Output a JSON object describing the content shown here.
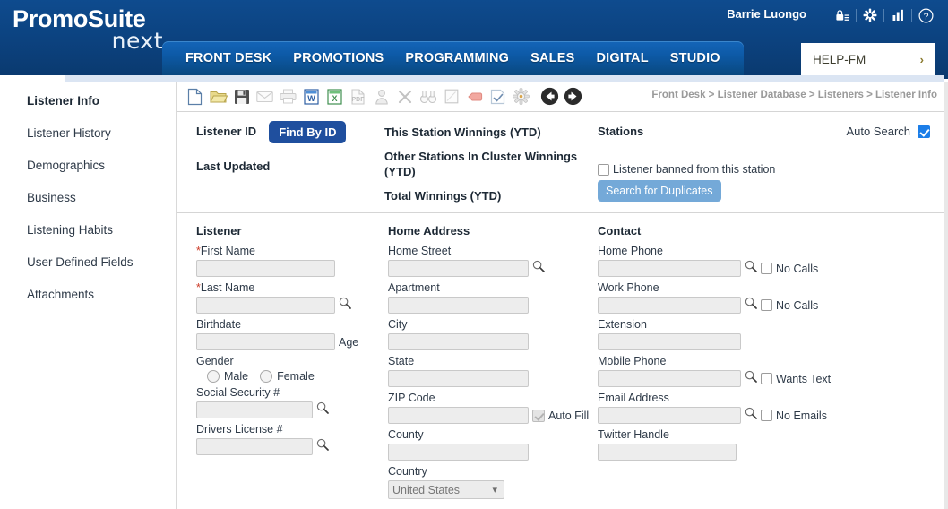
{
  "header": {
    "logo_main": "PromoSuite",
    "logo_sub": "next",
    "user_name": "Barrie Luongo",
    "icons": [
      {
        "name": "badge-lock-icon",
        "glyph": "lock-list"
      },
      {
        "name": "gear-icon",
        "glyph": "gear"
      },
      {
        "name": "bar-chart-icon",
        "glyph": "bars"
      },
      {
        "name": "help-icon",
        "glyph": "question"
      }
    ],
    "brand_dark": "#0c4381",
    "nav_blue": "#0d5aa7"
  },
  "nav": {
    "items": [
      {
        "label": "FRONT DESK"
      },
      {
        "label": "PROMOTIONS"
      },
      {
        "label": "PROGRAMMING"
      },
      {
        "label": "SALES"
      },
      {
        "label": "DIGITAL"
      },
      {
        "label": "STUDIO"
      }
    ],
    "station": {
      "label": "HELP-FM",
      "chevron": "›"
    }
  },
  "sidebar": {
    "items": [
      {
        "label": "Listener Info",
        "active": true
      },
      {
        "label": "Listener History",
        "active": false
      },
      {
        "label": "Demographics",
        "active": false
      },
      {
        "label": "Business",
        "active": false
      },
      {
        "label": "Listening Habits",
        "active": false
      },
      {
        "label": "User Defined Fields",
        "active": false
      },
      {
        "label": "Attachments",
        "active": false
      }
    ]
  },
  "toolbar": {
    "icons": [
      {
        "name": "new-document-icon"
      },
      {
        "name": "open-folder-icon"
      },
      {
        "name": "save-disk-icon"
      },
      {
        "name": "email-icon"
      },
      {
        "name": "print-icon"
      },
      {
        "name": "export-word-icon"
      },
      {
        "name": "export-excel-icon"
      },
      {
        "name": "export-pdf-icon"
      },
      {
        "name": "contact-person-icon"
      },
      {
        "name": "delete-x-icon"
      },
      {
        "name": "binoculars-icon"
      },
      {
        "name": "notepad-icon"
      },
      {
        "name": "eraser-icon"
      },
      {
        "name": "checklist-icon"
      },
      {
        "name": "settings-gear-icon"
      },
      {
        "name": "back-arrow-icon"
      },
      {
        "name": "forward-arrow-icon"
      }
    ],
    "breadcrumb": "Front Desk > Listener Database > Listeners > Listener Info"
  },
  "info_panel": {
    "listener_id_label": "Listener ID",
    "listener_id_value": "",
    "find_by_id_label": "Find By ID",
    "last_updated_label": "Last Updated",
    "last_updated_value": "",
    "winnings": [
      {
        "label": "This Station Winnings (YTD)",
        "value": ""
      },
      {
        "label": "Other Stations In Cluster Winnings (YTD)",
        "value": ""
      },
      {
        "label": "Total Winnings (YTD)",
        "value": ""
      }
    ],
    "stations_label": "Stations",
    "auto_search_label": "Auto Search",
    "auto_search_checked": true,
    "banned_label": "Listener banned from this station",
    "banned_checked": false,
    "search_duplicates_label": "Search for Duplicates"
  },
  "form": {
    "listener": {
      "title": "Listener",
      "first_name_label": "First Name",
      "first_name_required": "*",
      "first_name_value": "",
      "last_name_label": "Last Name",
      "last_name_required": "*",
      "last_name_value": "",
      "birthdate_label": "Birthdate",
      "birthdate_value": "",
      "age_label": "Age",
      "gender_label": "Gender",
      "gender_male": "Male",
      "gender_female": "Female",
      "ssn_label": "Social Security #",
      "ssn_value": "",
      "dl_label": "Drivers License #",
      "dl_value": ""
    },
    "home_address": {
      "title": "Home Address",
      "street_label": "Home Street",
      "street_value": "",
      "apartment_label": "Apartment",
      "apartment_value": "",
      "city_label": "City",
      "city_value": "",
      "state_label": "State",
      "state_value": "",
      "zip_label": "ZIP Code",
      "zip_value": "",
      "auto_fill_label": "Auto Fill",
      "auto_fill_checked": true,
      "county_label": "County",
      "county_value": "",
      "country_label": "Country",
      "country_value": "United States",
      "country_options": [
        "United States"
      ]
    },
    "contact": {
      "title": "Contact",
      "home_phone_label": "Home Phone",
      "home_phone_value": "",
      "home_no_calls_label": "No Calls",
      "work_phone_label": "Work Phone",
      "work_phone_value": "",
      "work_no_calls_label": "No Calls",
      "extension_label": "Extension",
      "extension_value": "",
      "mobile_label": "Mobile Phone",
      "mobile_value": "",
      "wants_text_label": "Wants Text",
      "email_label": "Email Address",
      "email_value": "",
      "no_emails_label": "No Emails",
      "twitter_label": "Twitter Handle",
      "twitter_value": ""
    }
  }
}
